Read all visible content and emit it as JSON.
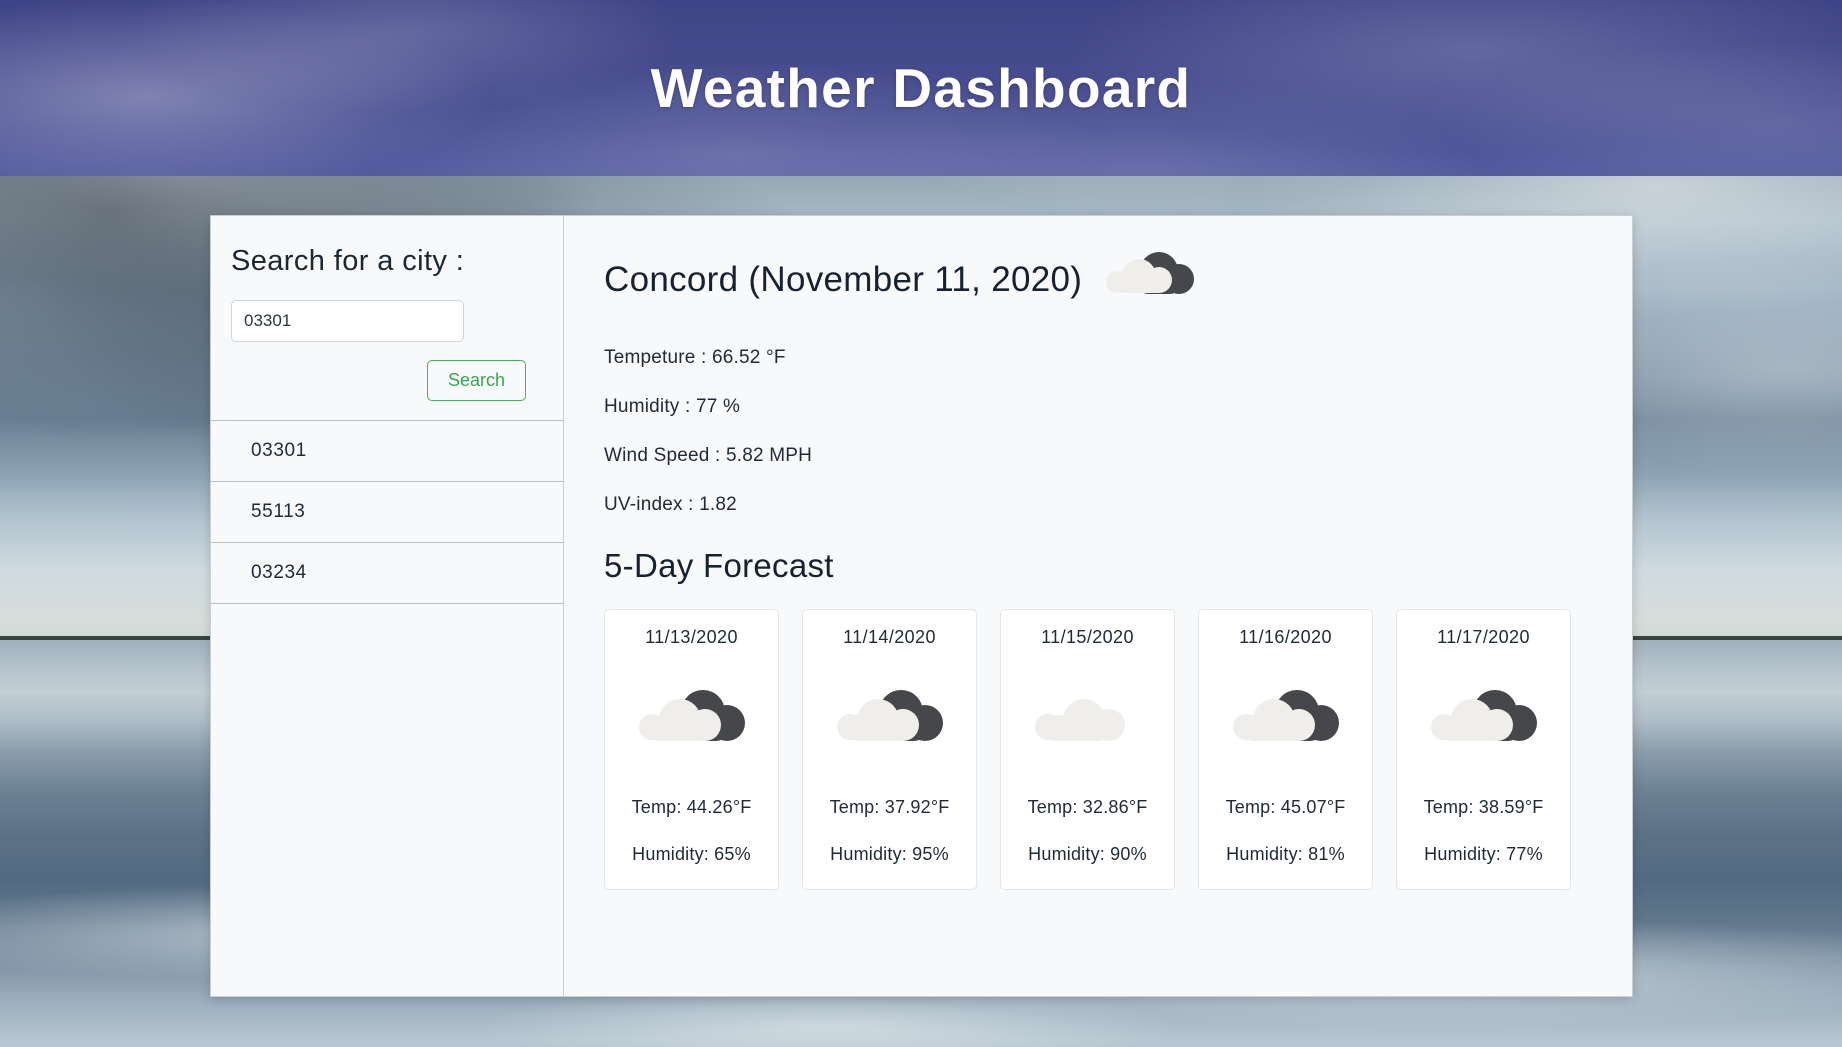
{
  "header": {
    "title": "Weather Dashboard",
    "background_color": "#464b8e",
    "title_color": "#ffffff"
  },
  "sidebar": {
    "heading": "Search for a city :",
    "search_input": {
      "value": "03301",
      "placeholder": ""
    },
    "search_button_label": "Search",
    "search_button_color": "#39a84c",
    "history": [
      {
        "label": "03301"
      },
      {
        "label": "55113"
      },
      {
        "label": "03234"
      }
    ]
  },
  "current": {
    "title": "Concord (November 11, 2020)",
    "icon": "broken-clouds-icon",
    "details": [
      {
        "label": "Tempeture : 66.52 °F"
      },
      {
        "label": "Humidity : 77 %"
      },
      {
        "label": "Wind Speed : 5.82 MPH"
      },
      {
        "label": "UV-index : 1.82"
      }
    ],
    "temperature": "66.52",
    "temperature_unit": "°F",
    "humidity": "77",
    "humidity_unit": "%",
    "wind_speed": "5.82",
    "wind_speed_unit": "MPH",
    "uv_index": "1.82"
  },
  "forecast": {
    "heading": "5-Day Forecast",
    "cards": [
      {
        "date": "11/13/2020",
        "icon": "broken-clouds-icon",
        "temp": "Temp: 44.26°F",
        "humidity": "Humidity: 65%",
        "temp_value": "44.26",
        "humidity_value": "65"
      },
      {
        "date": "11/14/2020",
        "icon": "broken-clouds-icon",
        "temp": "Temp: 37.92°F",
        "humidity": "Humidity: 95%",
        "temp_value": "37.92",
        "humidity_value": "95"
      },
      {
        "date": "11/15/2020",
        "icon": "overcast-clouds-icon",
        "temp": "Temp: 32.86°F",
        "humidity": "Humidity: 90%",
        "temp_value": "32.86",
        "humidity_value": "90"
      },
      {
        "date": "11/16/2020",
        "icon": "broken-clouds-icon",
        "temp": "Temp: 45.07°F",
        "humidity": "Humidity: 81%",
        "temp_value": "45.07",
        "humidity_value": "81"
      },
      {
        "date": "11/17/2020",
        "icon": "broken-clouds-icon",
        "temp": "Temp: 38.59°F",
        "humidity": "Humidity: 77%",
        "temp_value": "38.59",
        "humidity_value": "77"
      }
    ]
  }
}
